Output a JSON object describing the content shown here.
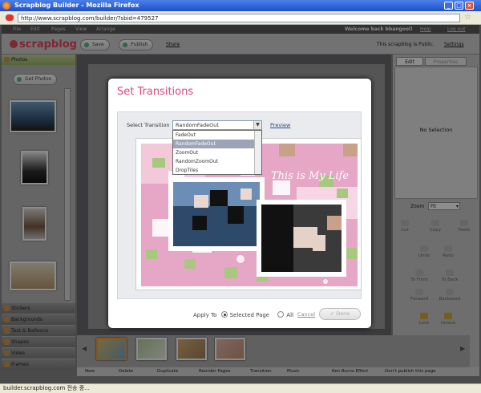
{
  "window": {
    "title": "Scrapblog Builder - Mozilla Firefox",
    "url": "http://www.scrapblog.com/builder/?sbid=479527"
  },
  "menu": {
    "items": [
      "File",
      "Edit",
      "Pages",
      "View",
      "Arrange"
    ],
    "welcome": "Welcome back bbangool!",
    "help": "Help",
    "logout": "Log out"
  },
  "header": {
    "logo": "scrapblog",
    "save": "Save",
    "publish": "Publish",
    "share": "Share",
    "public_note": "This scrapblog is Public.",
    "settings": "Settings"
  },
  "left_panel": {
    "photos": "Photos",
    "get_photos": "Get Photos",
    "sections": [
      "Stickers",
      "Backgrounds",
      "Text & Balloons",
      "Shapes",
      "Video",
      "Frames"
    ]
  },
  "right_panel": {
    "tab_edit": "Edit",
    "tab_properties": "Properties",
    "no_selection": "No Selection",
    "zoom_label": "Zoom",
    "zoom_value": "Fit",
    "tools": [
      "Cut",
      "Copy",
      "Paste",
      "Undo",
      "Redo",
      "To Front",
      "To Back",
      "Forward",
      "Backward",
      "Lock",
      "Unlock"
    ]
  },
  "bottom_bar": {
    "items": [
      "New",
      "Delete",
      "Duplicate",
      "Reorder Pages",
      "Transition",
      "Music",
      "Ken Burns Effect",
      "Don't publish this page"
    ]
  },
  "status": "builder.scrapblog.com 전송 중...",
  "modal": {
    "title": "Set Transitions",
    "select_label": "Select Transition",
    "selected": "RandomFadeOut",
    "preview": "Preview",
    "options": [
      "FadeOut",
      "RandomFadeOut",
      "ZoomOut",
      "RandomZoomOut",
      "DropTiles"
    ],
    "preview_text": "This is My Life",
    "apply_to": "Apply To",
    "selected_page": "Selected Page",
    "all": "All",
    "cancel": "Cancel",
    "done": "Done"
  },
  "colors": {
    "accent": "#e0457b",
    "logo": "#e8455d"
  }
}
